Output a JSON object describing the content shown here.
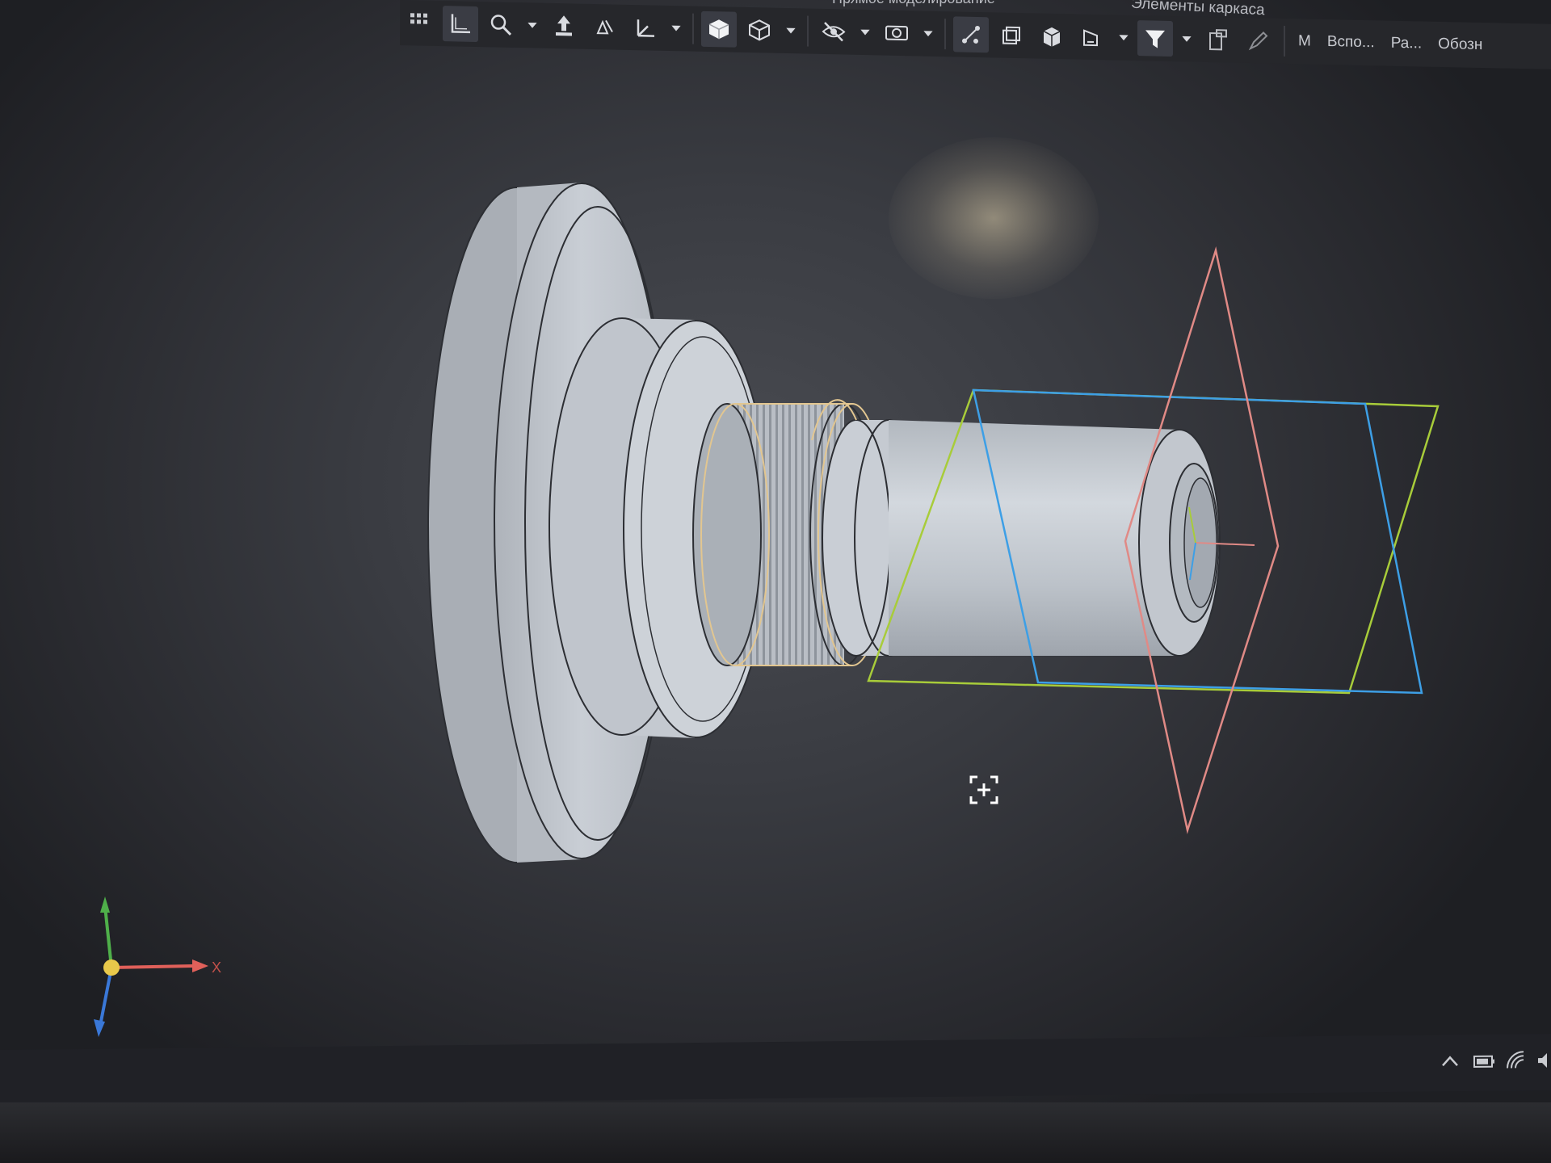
{
  "toolbar": {
    "ribbon_title": "Прямое моделирование",
    "frame_elements_label": "Элементы каркаса",
    "items": [
      {
        "name": "grid-menu-icon",
        "label": ""
      },
      {
        "name": "local-cs-icon",
        "label": ""
      },
      {
        "name": "zoom-icon",
        "label": ""
      },
      {
        "name": "move-icon",
        "label": ""
      },
      {
        "name": "rotate-icon",
        "label": ""
      },
      {
        "name": "orientation-icon",
        "label": ""
      },
      {
        "name": "shaded-view-icon",
        "label": ""
      },
      {
        "name": "wireframe-view-icon",
        "label": ""
      },
      {
        "name": "hide-icon",
        "label": ""
      },
      {
        "name": "display-icon",
        "label": ""
      },
      {
        "name": "measure-icon",
        "label": ""
      },
      {
        "name": "section-icon",
        "label": ""
      },
      {
        "name": "filter-icon",
        "label": ""
      },
      {
        "name": "pen-icon",
        "label": ""
      }
    ],
    "labels": {
      "m": "М",
      "aux": "Вспо...",
      "ra": "Ра...",
      "desig": "Обозн"
    }
  },
  "colors": {
    "background": "#3a3c42",
    "part_fill": "#c7ccd3",
    "plane_x": "#e08a86",
    "plane_y": "#a8cc3a",
    "plane_z": "#3d9fe6",
    "thread_highlight": "#e2c690",
    "axis_x": "#e0605a",
    "axis_y": "#4fb04a",
    "axis_z": "#3a78d8",
    "origin": "#e8c84a"
  },
  "triad": {
    "x_label": "X"
  },
  "cursor": {
    "icon": "zoom-to-fit-cursor-icon"
  },
  "tray": {
    "icons": [
      "chevron-up-icon",
      "battery-icon",
      "wifi-icon",
      "volume-icon"
    ]
  }
}
